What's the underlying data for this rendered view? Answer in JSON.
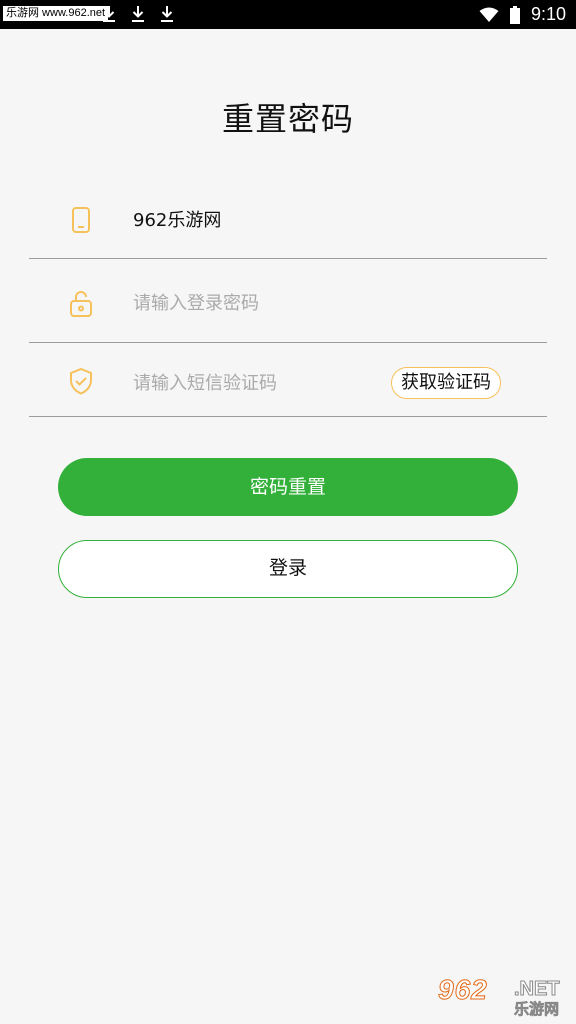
{
  "status_bar": {
    "watermark": "乐游网 www.962.net",
    "time": "9:10",
    "icons": [
      "download-icon",
      "download-icon",
      "download-icon",
      "wifi-icon",
      "battery-icon"
    ]
  },
  "title": "重置密码",
  "form": {
    "phone": {
      "icon": "phone-icon",
      "value": "962乐游网"
    },
    "password": {
      "icon": "unlock-icon",
      "placeholder": "请输入登录密码"
    },
    "sms_code": {
      "icon": "shield-check-icon",
      "placeholder": "请输入短信验证码",
      "button_label": "获取验证码"
    }
  },
  "actions": {
    "reset_label": "密码重置",
    "login_label": "登录"
  },
  "watermark_bottom": {
    "number": "962",
    "net": ".NET",
    "site_name": "乐游网"
  },
  "colors": {
    "primary_green": "#33b03a",
    "icon_orange": "#f6c15a",
    "background": "#f6f6f6",
    "placeholder": "#aaaaaa"
  }
}
